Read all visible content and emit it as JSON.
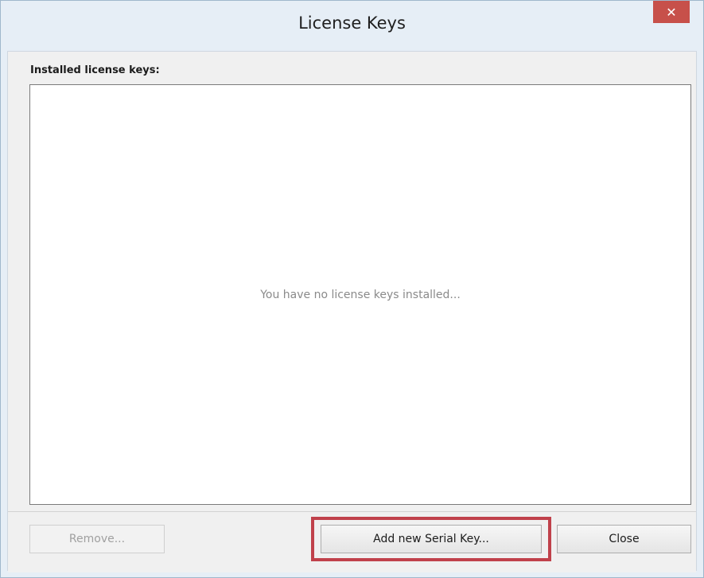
{
  "window": {
    "title": "License Keys",
    "close_glyph": "✕"
  },
  "main": {
    "section_label": "Installed license keys:",
    "empty_message": "You have no license keys installed..."
  },
  "buttons": {
    "remove_label": "Remove...",
    "add_label": "Add new Serial Key...",
    "close_label": "Close"
  },
  "colors": {
    "close_button": "#c7504a",
    "highlight_frame": "#c0414b",
    "window_frame": "#9fb7cc"
  },
  "icons": {
    "close": "close-icon"
  }
}
